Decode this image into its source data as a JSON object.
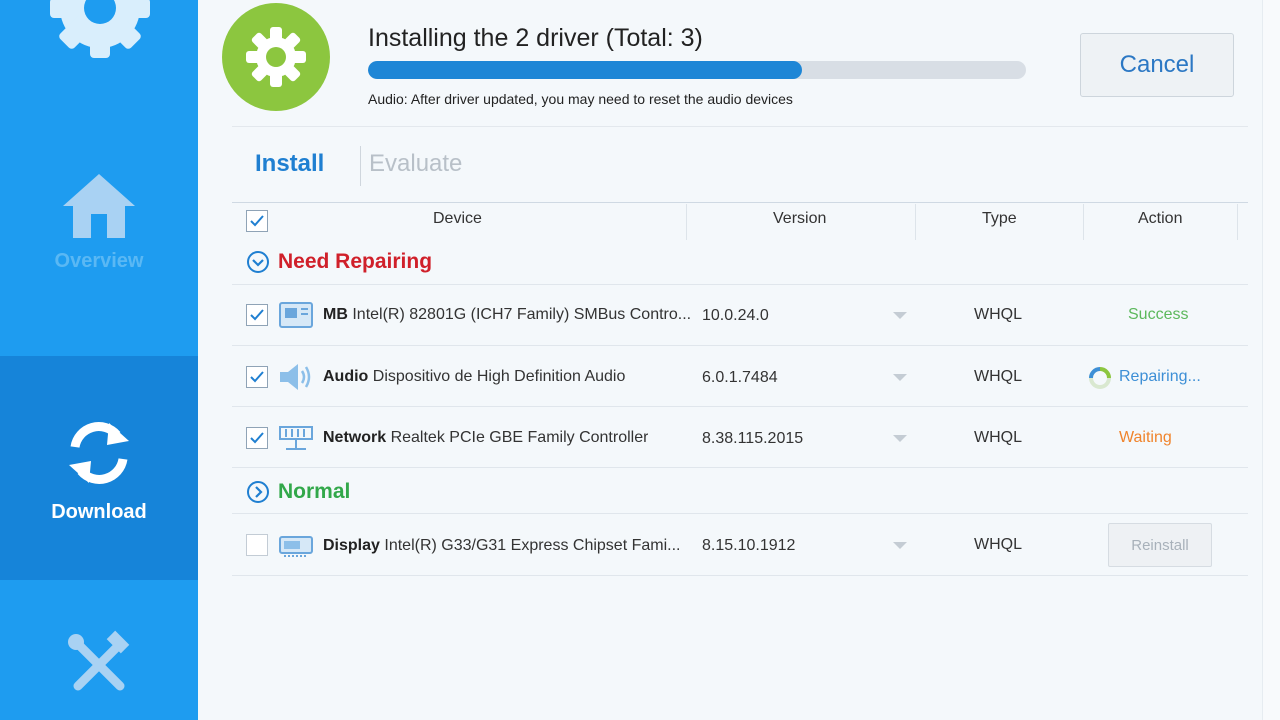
{
  "sidebar": {
    "items": [
      {
        "label": "Overview",
        "icon": "home-icon"
      },
      {
        "label": "Download",
        "icon": "refresh-icon"
      },
      {
        "label": "",
        "icon": "tools-icon"
      }
    ]
  },
  "header": {
    "title": "Installing the 2 driver (Total: 3)",
    "progress": 0.66,
    "note": "Audio: After driver updated, you may need to reset the audio devices",
    "cancel_label": "Cancel"
  },
  "tabs": [
    {
      "label": "Install",
      "active": true
    },
    {
      "label": "Evaluate",
      "active": false
    }
  ],
  "table": {
    "headers": [
      "Device",
      "Version",
      "Type",
      "Action"
    ],
    "groups": [
      {
        "label": "Need Repairing",
        "color": "#d0202a",
        "rows": [
          {
            "category": "MB",
            "name": "Intel(R) 82801G (ICH7 Family) SMBus Contro...",
            "version": "10.0.24.0",
            "type": "WHQL",
            "action": "Success",
            "action_color": "#5cb85c",
            "checked": true,
            "icon": "motherboard-icon"
          },
          {
            "category": "Audio",
            "name": "Dispositivo de High Definition Audio",
            "version": "6.0.1.7484",
            "type": "WHQL",
            "action": "Repairing...",
            "action_color": "#3d8fd6",
            "checked": true,
            "icon": "speaker-icon"
          },
          {
            "category": "Network",
            "name": "Realtek PCIe GBE Family Controller",
            "version": "8.38.115.2015",
            "type": "WHQL",
            "action": "Waiting",
            "action_color": "#f0842c",
            "checked": true,
            "icon": "network-icon"
          }
        ]
      },
      {
        "label": "Normal",
        "color": "#32a84a",
        "rows": [
          {
            "category": "Display",
            "name": "Intel(R) G33/G31 Express Chipset Fami...",
            "version": "8.15.10.1912",
            "type": "WHQL",
            "action": "Reinstall",
            "checked": false,
            "icon": "display-card-icon"
          }
        ]
      }
    ]
  },
  "colors": {
    "sidebar": "#1e9cf0",
    "sidebar_active": "#1684d9",
    "accent": "#1e86d6",
    "logo": "#8cc63f"
  }
}
